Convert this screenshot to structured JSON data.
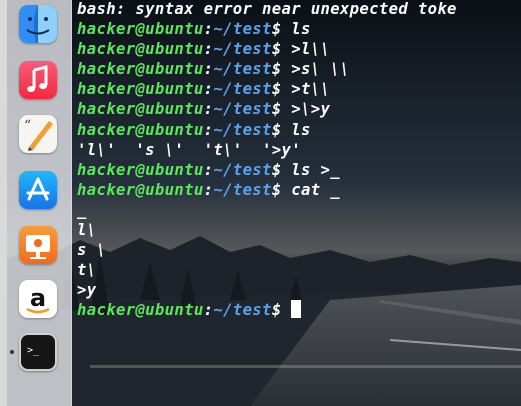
{
  "dock": {
    "items": [
      {
        "icon": "finder-icon"
      },
      {
        "icon": "music-icon"
      },
      {
        "icon": "script-editor-icon"
      },
      {
        "icon": "app-store-icon"
      },
      {
        "icon": "keynote-icon"
      },
      {
        "icon": "amazon-icon"
      },
      {
        "icon": "terminal-icon",
        "running": true
      }
    ]
  },
  "colors": {
    "user": "#5ce65c",
    "path": "#5aa2f0",
    "text": "#ffffff"
  },
  "terminal": {
    "lines": [
      {
        "type": "output",
        "text": "bash: syntax error near unexpected toke"
      },
      {
        "type": "prompt",
        "user": "hacker@ubuntu",
        "sep": ":",
        "path": "~/test",
        "dollar": "$ ",
        "cmd": "ls"
      },
      {
        "type": "prompt",
        "user": "hacker@ubuntu",
        "sep": ":",
        "path": "~/test",
        "dollar": "$ ",
        "cmd": ">l\\\\"
      },
      {
        "type": "prompt",
        "user": "hacker@ubuntu",
        "sep": ":",
        "path": "~/test",
        "dollar": "$ ",
        "cmd": ">s\\ \\\\"
      },
      {
        "type": "prompt",
        "user": "hacker@ubuntu",
        "sep": ":",
        "path": "~/test",
        "dollar": "$ ",
        "cmd": ">t\\\\"
      },
      {
        "type": "prompt",
        "user": "hacker@ubuntu",
        "sep": ":",
        "path": "~/test",
        "dollar": "$ ",
        "cmd": ">\\>y"
      },
      {
        "type": "prompt",
        "user": "hacker@ubuntu",
        "sep": ":",
        "path": "~/test",
        "dollar": "$ ",
        "cmd": "ls"
      },
      {
        "type": "output",
        "text": "'l\\'  's \\'  't\\'  '>y'"
      },
      {
        "type": "prompt",
        "user": "hacker@ubuntu",
        "sep": ":",
        "path": "~/test",
        "dollar": "$ ",
        "cmd": "ls >_"
      },
      {
        "type": "prompt",
        "user": "hacker@ubuntu",
        "sep": ":",
        "path": "~/test",
        "dollar": "$ ",
        "cmd": "cat _"
      },
      {
        "type": "output",
        "text": "_"
      },
      {
        "type": "output",
        "text": "l\\"
      },
      {
        "type": "output",
        "text": "s \\"
      },
      {
        "type": "output",
        "text": "t\\"
      },
      {
        "type": "output",
        "text": ">y"
      },
      {
        "type": "prompt",
        "user": "hacker@ubuntu",
        "sep": ":",
        "path": "~/test",
        "dollar": "$ ",
        "cmd": "",
        "cursor": true
      }
    ]
  }
}
